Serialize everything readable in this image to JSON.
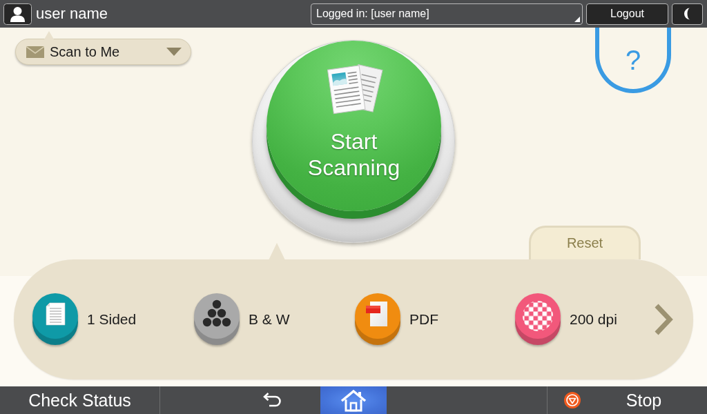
{
  "top_bar": {
    "user_name": "user name",
    "login_status": "Logged in: [user name]",
    "logout": "Logout"
  },
  "job_selector": {
    "label": "Scan to Me"
  },
  "help": {
    "label": "?"
  },
  "start_button": {
    "label": "Start Scanning"
  },
  "reset": {
    "label": "Reset"
  },
  "settings": [
    {
      "kind": "sides",
      "label": "1 Sided",
      "color": "#0f9aa7"
    },
    {
      "kind": "color_mode",
      "label": "B & W",
      "color": "#a9a9a9"
    },
    {
      "kind": "file_type",
      "label": "PDF",
      "color": "#f08c10"
    },
    {
      "kind": "resolution",
      "label": "200 dpi",
      "color": "#f2587b"
    }
  ],
  "bottom_bar": {
    "check_status": "Check Status",
    "nav": [
      {
        "kind": "back",
        "selected": false
      },
      {
        "kind": "home",
        "selected": true
      }
    ],
    "stop": "Stop"
  }
}
